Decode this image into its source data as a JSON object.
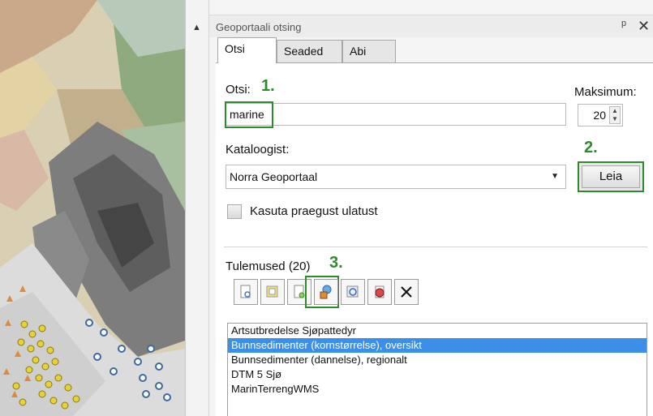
{
  "panel": {
    "title": "Geoportaali otsing",
    "pin_icon": "pin-icon",
    "close_icon": "close-icon"
  },
  "divider": {
    "arrow_icon": "up-arrow-icon"
  },
  "tabs": [
    {
      "label": "Otsi",
      "active": true
    },
    {
      "label": "Seaded",
      "active": false
    },
    {
      "label": "Abi",
      "active": false
    }
  ],
  "search": {
    "label": "Otsi:",
    "step": "1.",
    "value": "marine"
  },
  "maximum": {
    "label": "Maksimum:",
    "value": "20"
  },
  "catalog": {
    "label": "Kataloogist:",
    "step": "2.",
    "selected": "Norra Geoportaal"
  },
  "leia_button": {
    "label": "Leia"
  },
  "extent_checkbox": {
    "label": "Kasuta praegust ulatust",
    "checked": false
  },
  "results": {
    "label": "Tulemused (20)",
    "step": "3.",
    "toolbar_icons": [
      "view-metadata-icon",
      "open-icon",
      "add-to-map-icon",
      "globe-database-icon",
      "zoom-to-icon",
      "download-icon",
      "clear-icon"
    ],
    "items": [
      {
        "text": "Artsutbredelse Sjøpattedyr",
        "selected": false
      },
      {
        "text": "Bunnsedimenter (kornstørrelse), oversikt",
        "selected": true
      },
      {
        "text": "Bunnsedimenter (dannelse), regionalt",
        "selected": false
      },
      {
        "text": "DTM 5 Sjø",
        "selected": false
      },
      {
        "text": "MarinTerrengWMS",
        "selected": false
      }
    ]
  },
  "colors": {
    "highlight_green": "#2e8a2e",
    "selection_blue": "#3b8fe6"
  }
}
